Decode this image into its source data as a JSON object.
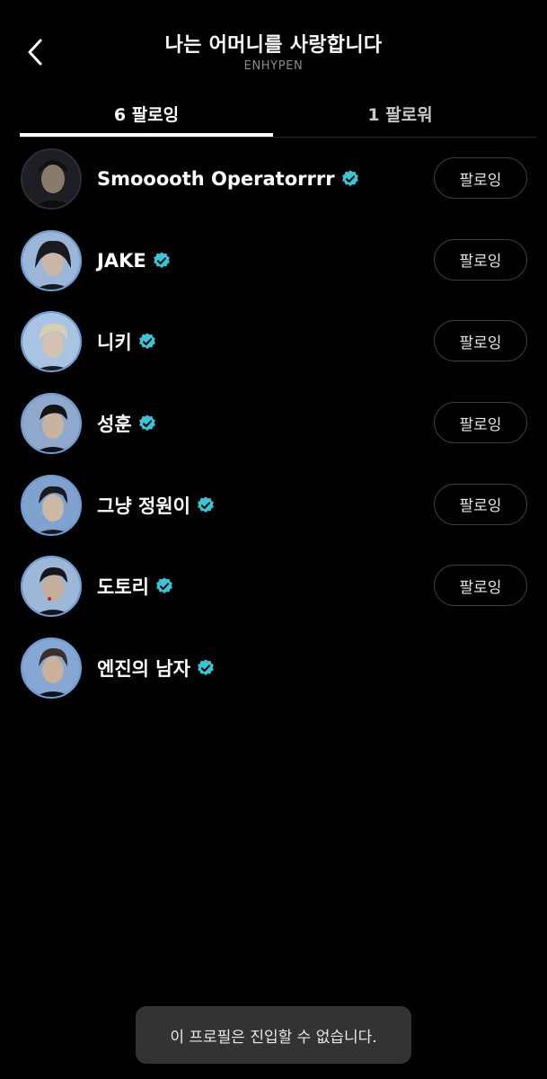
{
  "header": {
    "title": "나는 어머니를 사랑합니다",
    "subtitle": "ENHYPEN",
    "back_icon": "chevron-left-icon"
  },
  "tabs": [
    {
      "label": "6 팔로잉",
      "active": true
    },
    {
      "label": "1 팔로워",
      "active": false
    }
  ],
  "accounts": [
    {
      "name": "Smooooth Operatorrrr",
      "verified": true,
      "button": "팔로잉"
    },
    {
      "name": "JAKE",
      "verified": true,
      "button": "팔로잉"
    },
    {
      "name": "니키",
      "verified": true,
      "button": "팔로잉"
    },
    {
      "name": "성훈",
      "verified": true,
      "button": "팔로잉"
    },
    {
      "name": "그냥 정원이",
      "verified": true,
      "button": "팔로잉"
    },
    {
      "name": "도토리",
      "verified": true,
      "button": "팔로잉"
    },
    {
      "name": "엔진의 남자",
      "verified": true
    }
  ],
  "toast": {
    "message": "이 프로필은 진입할 수 없습니다."
  },
  "colors": {
    "background": "#000000",
    "verified_badge": "#36c6d6",
    "tab_underline": "#ffffff",
    "button_border": "#3c3c3c",
    "toast_bg": "#333333"
  }
}
